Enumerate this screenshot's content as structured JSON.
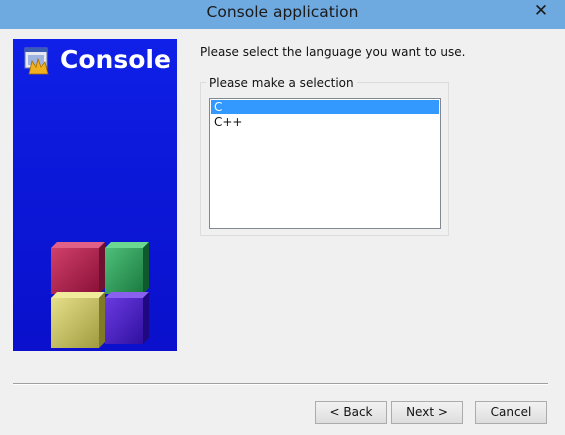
{
  "window": {
    "title": "Console application",
    "close_glyph": "✕"
  },
  "side_panel": {
    "title": "Console",
    "logo_icon": "codeblocks-logo-icon",
    "colors": {
      "background": "#0c18d8"
    }
  },
  "main": {
    "prompt": "Please select the language you want to use.",
    "group_label": "Please make a selection",
    "languages": [
      {
        "label": "C",
        "selected": true
      },
      {
        "label": "C++",
        "selected": false
      }
    ]
  },
  "buttons": {
    "back_label": "< Back",
    "next_label": "Next >",
    "cancel_label": "Cancel"
  },
  "colors": {
    "titlebar": "#6ea9e0",
    "selection": "#3399ff",
    "dialog_bg": "#f0f0f0"
  }
}
